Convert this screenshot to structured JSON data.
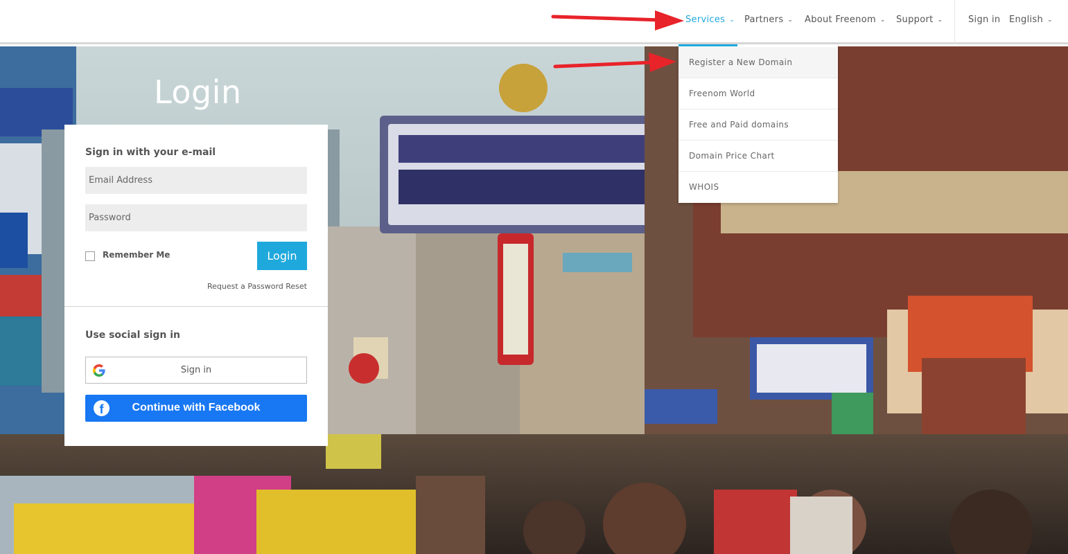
{
  "nav": {
    "items": [
      {
        "label": "Services",
        "active": true
      },
      {
        "label": "Partners",
        "active": false
      },
      {
        "label": "About Freenom",
        "active": false
      },
      {
        "label": "Support",
        "active": false
      }
    ],
    "sign_in": "Sign in",
    "language": "English"
  },
  "services_dropdown": {
    "items": [
      "Register a New Domain",
      "Freenom World",
      "Free and Paid domains",
      "Domain Price Chart",
      "WHOIS"
    ]
  },
  "login": {
    "title": "Login",
    "email_heading": "Sign in with your e-mail",
    "email_placeholder": "Email Address",
    "password_placeholder": "Password",
    "remember_label": "Remember Me",
    "login_button": "Login",
    "reset_link": "Request a Password Reset",
    "social_heading": "Use social sign in",
    "google_button": "Sign in",
    "facebook_button": "Continue with Facebook"
  },
  "colors": {
    "accent": "#1fa8dc",
    "facebook": "#1877f2",
    "annotation_arrow": "#e8232a"
  }
}
